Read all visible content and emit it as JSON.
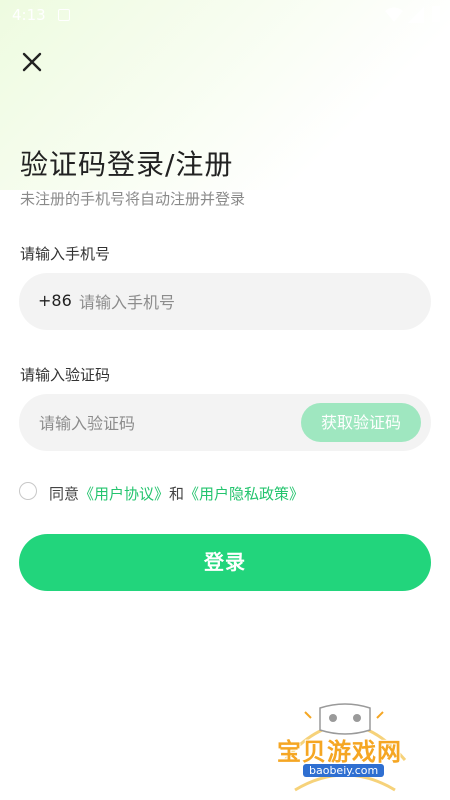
{
  "status_bar": {
    "time": "4:13",
    "icons": [
      "notification-icon",
      "wifi-icon",
      "signal-icon",
      "battery-icon"
    ]
  },
  "header": {
    "close_icon": "close-icon",
    "title": "验证码登录/注册",
    "subtitle": "未注册的手机号将自动注册并登录"
  },
  "phone": {
    "label": "请输入手机号",
    "country_code": "+86",
    "placeholder": "请输入手机号",
    "value": ""
  },
  "code": {
    "label": "请输入验证码",
    "placeholder": "请输入验证码",
    "value": "",
    "get_code_label": "获取验证码"
  },
  "agreement": {
    "checked": false,
    "prefix": "同意",
    "user_agreement": "《用户协议》",
    "and": "和",
    "privacy_policy": "《用户隐私政策》"
  },
  "login_button": "登录",
  "watermark": {
    "title": "宝贝游戏网",
    "url": "baobeiy.com"
  },
  "colors": {
    "accent": "#22d57c",
    "accent_light": "#9fe7c0",
    "link": "#24c46e",
    "input_bg": "#f3f3f3"
  }
}
